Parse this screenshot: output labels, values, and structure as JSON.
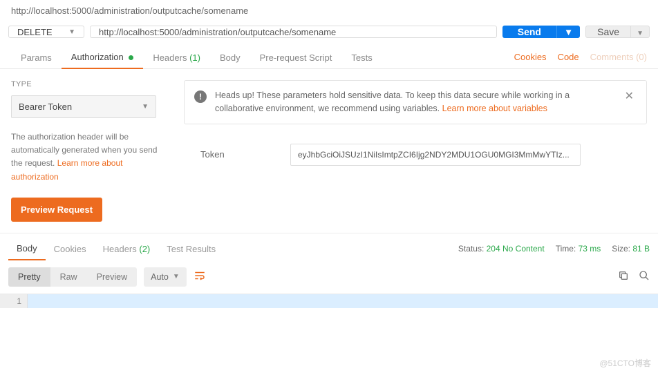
{
  "breadcrumb": "http://localhost:5000/administration/outputcache/somename",
  "request": {
    "method": "DELETE",
    "url": "http://localhost:5000/administration/outputcache/somename",
    "send_label": "Send",
    "save_label": "Save"
  },
  "tabs": {
    "params": "Params",
    "authorization": "Authorization",
    "headers": "Headers",
    "headers_count": "(1)",
    "body": "Body",
    "prerequest": "Pre-request Script",
    "tests": "Tests"
  },
  "right_links": {
    "cookies": "Cookies",
    "code": "Code",
    "comments": "Comments (0)"
  },
  "auth": {
    "type_label": "TYPE",
    "type_value": "Bearer Token",
    "note_text": "The authorization header will be automatically generated when you send the request. ",
    "note_link": "Learn more about authorization",
    "preview_label": "Preview Request",
    "banner_text": "Heads up! These parameters hold sensitive data. To keep this data secure while working in a collaborative environment, we recommend using variables. ",
    "banner_link": "Learn more about variables",
    "token_label": "Token",
    "token_value": "eyJhbGciOiJSUzI1NiIsImtpZCI6Ijg2NDY2MDU1OGU0MGI3MmMwYTIz..."
  },
  "response": {
    "tabs": {
      "body": "Body",
      "cookies": "Cookies",
      "headers": "Headers",
      "headers_count": "(2)",
      "testresults": "Test Results"
    },
    "status_label": "Status:",
    "status_value": "204 No Content",
    "time_label": "Time:",
    "time_value": "73 ms",
    "size_label": "Size:",
    "size_value": "81 B",
    "toolbar": {
      "pretty": "Pretty",
      "raw": "Raw",
      "preview": "Preview",
      "auto": "Auto"
    },
    "line_no": "1"
  },
  "watermark": "@51CTO博客"
}
